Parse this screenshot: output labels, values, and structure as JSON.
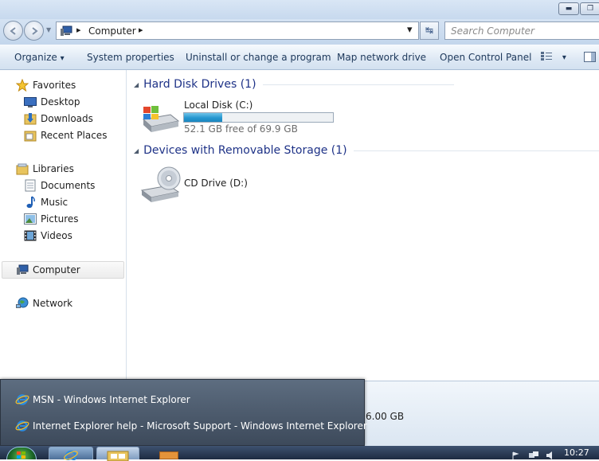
{
  "titlebar": {
    "minimize_glyph": "▬",
    "restore_glyph": "❐"
  },
  "address": {
    "separator1": "▸",
    "location": "Computer",
    "separator2": "▸",
    "dropdown_glyph": "▾",
    "refresh_glyph": "↹",
    "search_placeholder": "Search Computer"
  },
  "toolbar": {
    "organize": "Organize",
    "organize_arrow": "▾",
    "system_properties": "System properties",
    "uninstall": "Uninstall or change a program",
    "map_drive": "Map network drive",
    "control_panel": "Open Control Panel",
    "views_arrow": "▾"
  },
  "nav": {
    "favorites": "Favorites",
    "desktop": "Desktop",
    "downloads": "Downloads",
    "recent": "Recent Places",
    "libraries": "Libraries",
    "documents": "Documents",
    "music": "Music",
    "pictures": "Pictures",
    "videos": "Videos",
    "computer": "Computer",
    "network": "Network"
  },
  "content": {
    "hdd_group": "Hard Disk Drives (1)",
    "local_disk_name": "Local Disk (C:)",
    "local_disk_free": "52.1 GB free of 69.9 GB",
    "local_disk_used_fraction": 0.255,
    "removable_group": "Devices with Removable Storage (1)",
    "cd_drive_name": "CD Drive (D:)",
    "details_memory": "6.00 GB"
  },
  "taskbar_popup": {
    "item1": "MSN - Windows Internet Explorer",
    "item2": "Internet Explorer help - Microsoft Support - Windows Internet Explorer"
  },
  "taskbar": {
    "clock": "10:27"
  },
  "colors": {
    "accent": "#1e3287",
    "progress": "#2596cf",
    "taskbar": "#1d2b41"
  }
}
